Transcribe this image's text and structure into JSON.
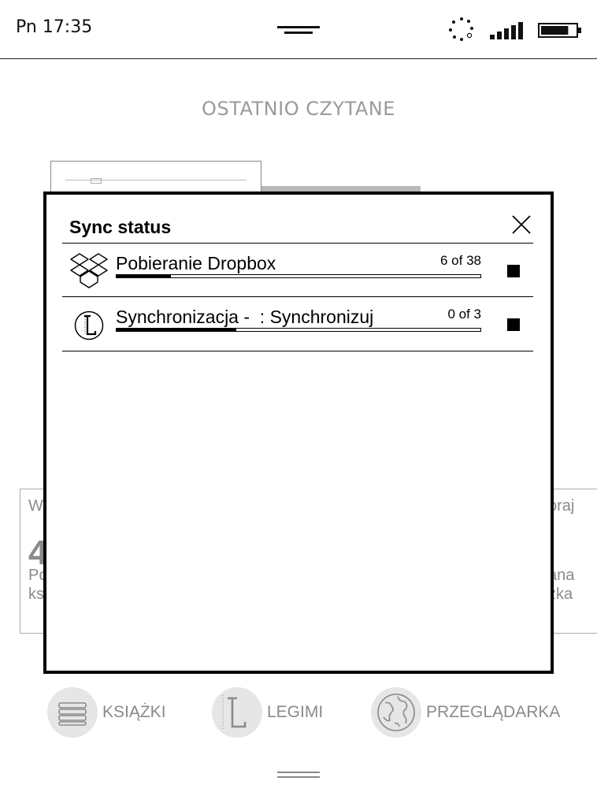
{
  "status_bar": {
    "clock": "Pn 17:35",
    "icons": [
      "menu-handle",
      "sync-icon",
      "signal-icon",
      "battery-icon"
    ],
    "battery_level": 0.8
  },
  "home": {
    "section_title": "OSTATNIO CZYTANE",
    "stats_left": {
      "line1": "W",
      "number": "4",
      "line2": "Po",
      "line3": "ks"
    },
    "stats_right": {
      "line1": "oraj",
      "line2": "ana",
      "line3": "żka"
    }
  },
  "dialog": {
    "title": "Sync status",
    "close_icon": "close-icon",
    "rows": [
      {
        "icon": "dropbox-icon",
        "label": "Pobieranie Dropbox",
        "count": "6 of 38",
        "progress": 0.15
      },
      {
        "icon": "legimi-icon",
        "label": "Synchronizacja -  : Synchronizuj",
        "count": "0 of 3",
        "progress": 0.33
      }
    ]
  },
  "nav": {
    "items": [
      {
        "icon": "books-icon",
        "label": "KSIĄŻKI"
      },
      {
        "icon": "legimi-icon",
        "label": "LEGIMI"
      },
      {
        "icon": "globe-icon",
        "label": "PRZEGLĄDARKA"
      }
    ]
  },
  "colors": {
    "ink": "#000000",
    "dim_text": "#8a8a8a",
    "nav_circle": "#e6e6e6"
  }
}
